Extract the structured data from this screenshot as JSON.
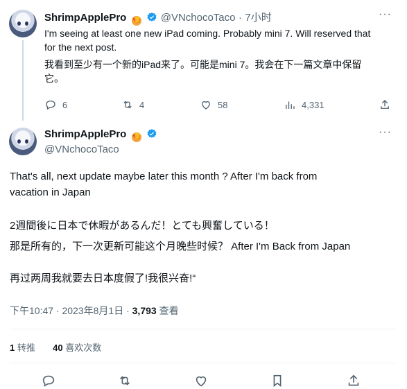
{
  "reply": {
    "author_name": "ShrimpApplePro",
    "badge_glyph": "🍤",
    "handle": "@VNchocoTaco",
    "separator": "·",
    "time": "7小时",
    "text_en_line1": "I'm seeing at least one new iPad coming. Probably mini 7. Will reserved that",
    "text_en_line2": "for the next post.",
    "text_cn_line1": "我看到至少有一个新的iPad来了。可能是mini 7。我会在下一篇文章中保留",
    "text_cn_line2": "它。",
    "replies": "6",
    "retweets": "4",
    "likes": "58",
    "views": "4,331"
  },
  "main": {
    "author_name": "ShrimpApplePro",
    "badge_glyph": "🍤",
    "handle": "@VNchocoTaco",
    "line1": "That's all, next update maybe later this month ? After I'm back from",
    "line2": "vacation in Japan",
    "line3": "2週間後に日本で休暇があるんだ！とても興奮している！",
    "line4": "那是所有的，下一次更新可能这个月晚些时候？ After I'm Back from Japan",
    "line5": "再过两周我就要去日本度假了!我很兴奋!“",
    "timestamp": "下午10:47 · 2023年8月1日 · ",
    "views_count": "3,793",
    "views_label": " 查看",
    "retweets_count": "1",
    "retweets_label": " 转推",
    "likes_count": "40",
    "likes_label": " 喜欢次数"
  },
  "colors": {
    "verified": "#1d9bf0",
    "muted": "#536471",
    "text": "#0f1419"
  },
  "icons": [
    "reply-icon",
    "retweet-icon",
    "like-icon",
    "views-icon",
    "share-icon",
    "bookmark-icon",
    "more-icon",
    "verified-icon"
  ]
}
